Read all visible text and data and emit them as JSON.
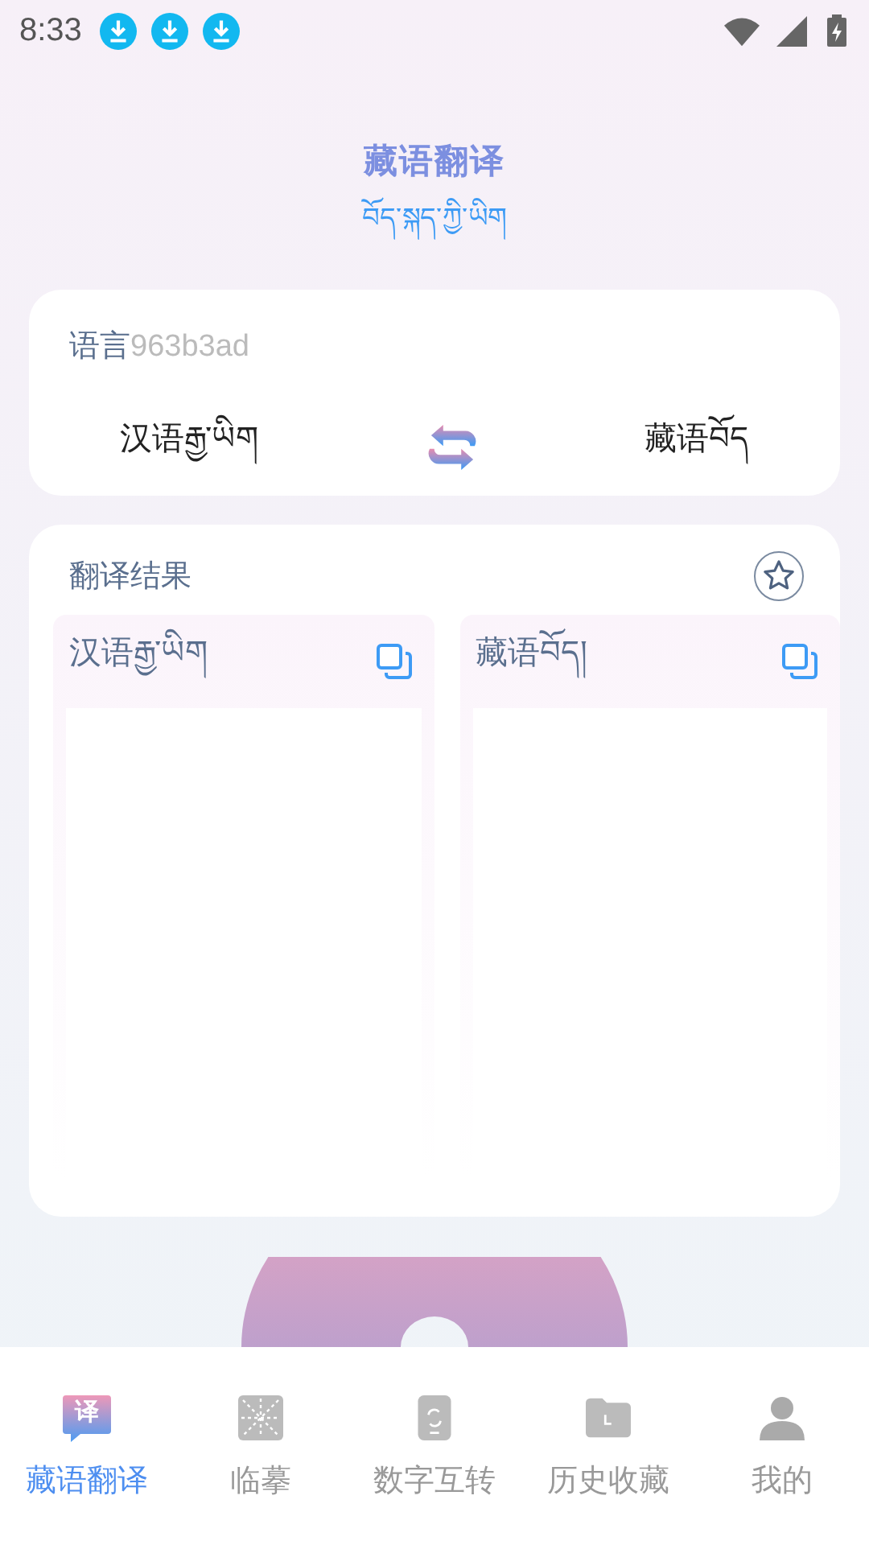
{
  "status_bar": {
    "time": "8:33",
    "notifications": [
      {
        "kind": "download"
      },
      {
        "kind": "download"
      },
      {
        "kind": "download"
      }
    ]
  },
  "header": {
    "title": "藏语翻译",
    "subtitle": "བོད་སྐད་ཀྱི་ཡིག"
  },
  "language_card": {
    "label": "语言",
    "code": "963b3ad",
    "source": "汉语རྒྱ་ཡིག",
    "target": "藏语བོད"
  },
  "result_card": {
    "title": "翻译结果",
    "favorited": false,
    "panes": [
      {
        "label": "汉语རྒྱ་ཡིག"
      },
      {
        "label": "藏语བོད།"
      }
    ]
  },
  "tabs": [
    {
      "label": "藏语翻译",
      "kind": "translate",
      "badge": "译",
      "selected": true
    },
    {
      "label": "临摹",
      "kind": "grid",
      "selected": false
    },
    {
      "label": "数字互转",
      "kind": "phone",
      "selected": false
    },
    {
      "label": "历史收藏",
      "kind": "folder",
      "selected": false
    },
    {
      "label": "我的",
      "kind": "person",
      "selected": false
    }
  ]
}
